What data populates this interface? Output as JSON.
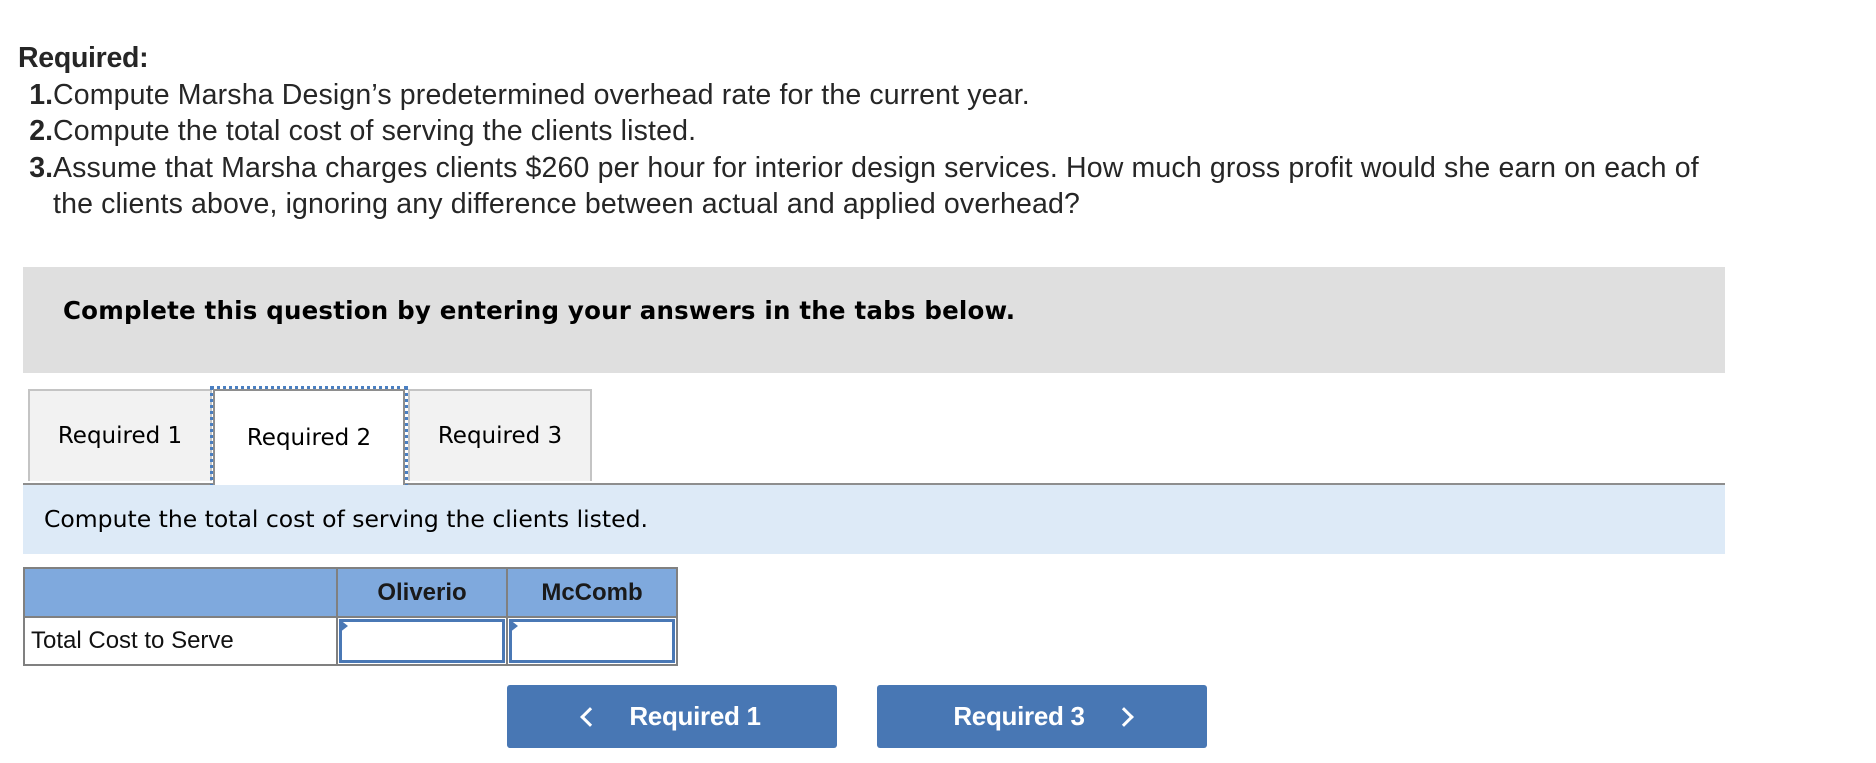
{
  "required": {
    "heading": "Required:",
    "items": [
      {
        "number": "1.",
        "text": "Compute Marsha Design’s predetermined overhead rate for the current year."
      },
      {
        "number": "2.",
        "text": "Compute the total cost of serving the clients listed."
      },
      {
        "number": "3.",
        "text": "Assume that Marsha charges clients $260 per hour for interior design services. How much gross profit would she earn on each of",
        "continuation": "the clients above, ignoring any difference between actual and applied overhead?"
      }
    ]
  },
  "instruction": "Complete this question by entering your answers in the tabs below.",
  "tabs": [
    {
      "label": "Required 1",
      "active": false
    },
    {
      "label": "Required 2",
      "active": true
    },
    {
      "label": "Required 3",
      "active": false
    }
  ],
  "prompt": "Compute the total cost of serving the clients listed.",
  "table": {
    "columns": [
      "",
      "Oliverio",
      "McComb"
    ],
    "rows": [
      {
        "label": "Total Cost to Serve",
        "values": [
          "",
          ""
        ]
      }
    ]
  },
  "navigation": {
    "prev_label": "Required 1",
    "next_label": "Required 3",
    "prev_icon": "chevron-left-icon",
    "next_icon": "chevron-right-icon"
  },
  "colors": {
    "button": "#4877b4",
    "table_header": "#7fa9dd",
    "prompt_panel": "#ddeaf7",
    "instruction_box": "#dfdfdf",
    "focus_outline": "#4a7fc1"
  }
}
